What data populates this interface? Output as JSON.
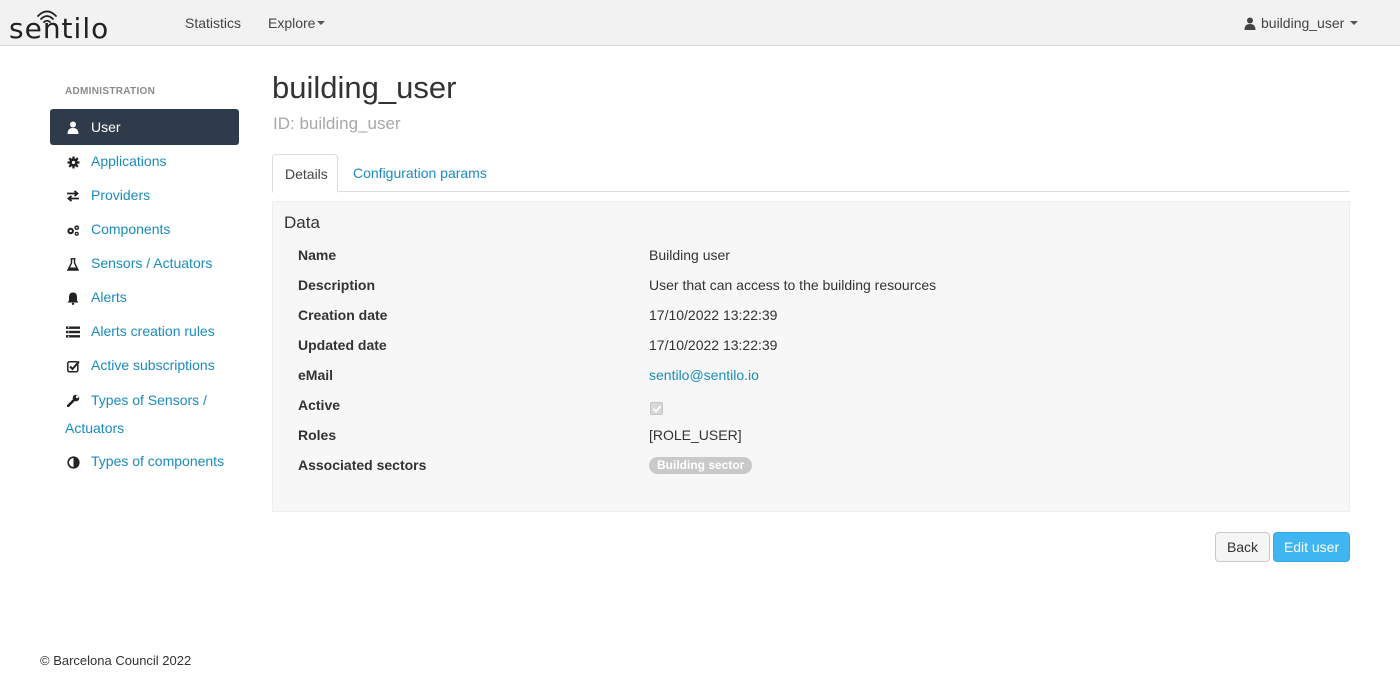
{
  "brand": {
    "name": "sentilo"
  },
  "nav": {
    "statistics": "Statistics",
    "explore": "Explore"
  },
  "user_menu": {
    "username": "building_user",
    "icon": "user-icon"
  },
  "sidebar": {
    "header": "ADMINISTRATION",
    "items": [
      {
        "label": "User",
        "icon": "user-icon",
        "active": true
      },
      {
        "label": "Applications",
        "icon": "gear-icon"
      },
      {
        "label": "Providers",
        "icon": "exchange-icon"
      },
      {
        "label": "Components",
        "icon": "gears-icon"
      },
      {
        "label": "Sensors / Actuators",
        "icon": "flask-icon"
      },
      {
        "label": "Alerts",
        "icon": "bell-icon"
      },
      {
        "label": "Alerts creation rules",
        "icon": "list-icon"
      },
      {
        "label": "Active subscriptions",
        "icon": "check-square-icon"
      },
      {
        "label_line1": "Types of Sensors /",
        "label_line2": "Actuators",
        "icon": "wrench-icon"
      },
      {
        "label": "Types of components",
        "icon": "contrast-icon"
      }
    ]
  },
  "page": {
    "title": "building_user",
    "subtitle": "ID: building_user"
  },
  "tabs": [
    {
      "label": "Details",
      "active": true
    },
    {
      "label": "Configuration params"
    }
  ],
  "panel": {
    "title": "Data",
    "rows": {
      "name": {
        "label": "Name",
        "value": "Building user"
      },
      "description": {
        "label": "Description",
        "value": "User that can access to the building resources"
      },
      "creation_date": {
        "label": "Creation date",
        "value": "17/10/2022 13:22:39"
      },
      "updated_date": {
        "label": "Updated date",
        "value": "17/10/2022 13:22:39"
      },
      "email": {
        "label": "eMail",
        "value": "sentilo@sentilo.io"
      },
      "active": {
        "label": "Active",
        "checked": true
      },
      "roles": {
        "label": "Roles",
        "value": "[ROLE_USER]"
      },
      "sectors": {
        "label": "Associated sectors",
        "badges": [
          "Building sector"
        ]
      }
    }
  },
  "buttons": {
    "back": "Back",
    "edit": "Edit user"
  },
  "footer": {
    "text": "© Barcelona Council 2022"
  },
  "colors": {
    "link": "#1a8bbf",
    "sidebar_active": "#2f3b4a",
    "primary_button": "#3fb6f2",
    "badge": "#c9c9c9"
  }
}
